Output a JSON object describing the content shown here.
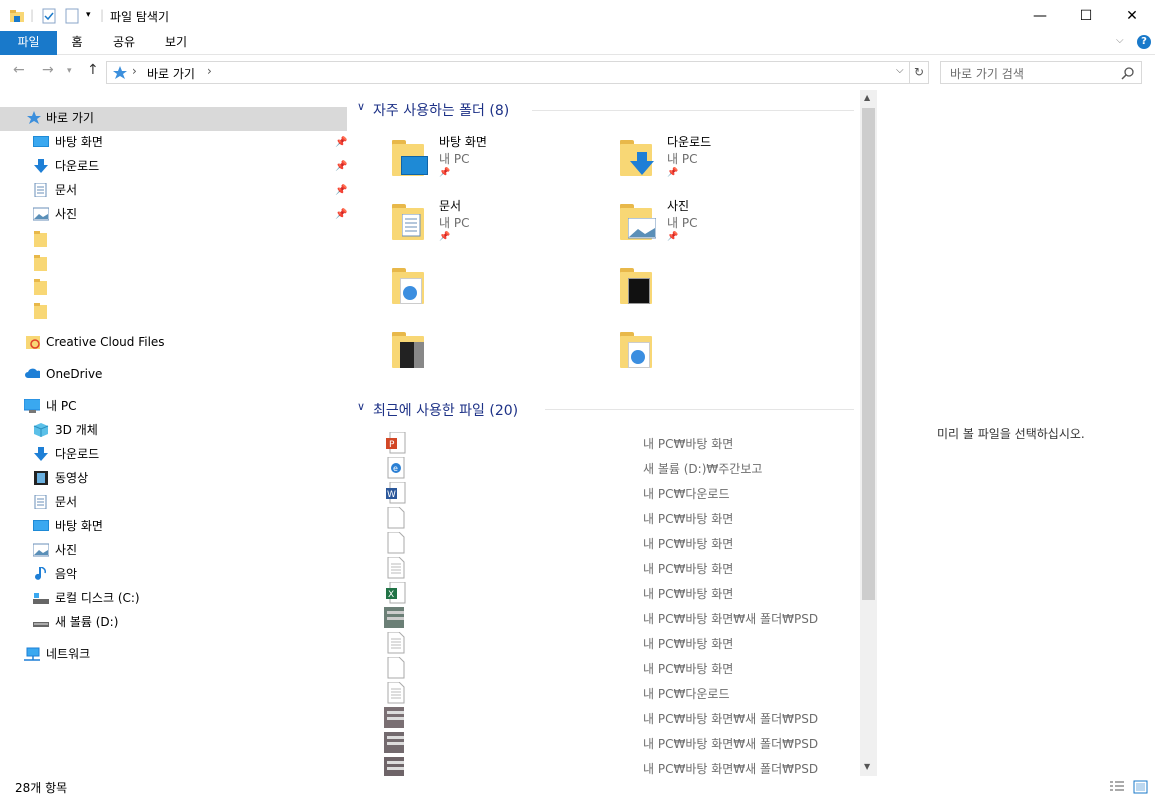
{
  "window": {
    "title": "파일 탐색기",
    "minimize_symbol": "—",
    "maximize_symbol": "☐",
    "close_symbol": "✕"
  },
  "ribbon": {
    "tabs": [
      "파일",
      "홈",
      "공유",
      "보기"
    ],
    "help": "?"
  },
  "address": {
    "crumb": "바로 가기",
    "separator": "›"
  },
  "search": {
    "placeholder": "바로 가기 검색"
  },
  "nav": {
    "quick_access": "바로 가기",
    "quick_items": [
      {
        "label": "바탕 화면",
        "icon": "desktop-icon",
        "pinned": true
      },
      {
        "label": "다운로드",
        "icon": "download-icon",
        "pinned": true
      },
      {
        "label": "문서",
        "icon": "documents-icon",
        "pinned": true
      },
      {
        "label": "사진",
        "icon": "pictures-icon",
        "pinned": true
      }
    ],
    "creative_cloud": "Creative Cloud Files",
    "onedrive": "OneDrive",
    "this_pc": "내 PC",
    "pc_items": [
      {
        "label": "3D 개체",
        "icon": "3d-objects-icon"
      },
      {
        "label": "다운로드",
        "icon": "download-icon"
      },
      {
        "label": "동영상",
        "icon": "videos-icon"
      },
      {
        "label": "문서",
        "icon": "documents-icon"
      },
      {
        "label": "바탕 화면",
        "icon": "desktop-icon"
      },
      {
        "label": "사진",
        "icon": "pictures-icon"
      },
      {
        "label": "음악",
        "icon": "music-icon"
      },
      {
        "label": "로컬 디스크 (C:)",
        "icon": "drive-icon"
      },
      {
        "label": "새 볼륨 (D:)",
        "icon": "drive-icon"
      }
    ],
    "network": "네트워크"
  },
  "frequent": {
    "header": "자주 사용하는 폴더 (8)",
    "folders": [
      {
        "name": "바탕 화면",
        "location": "내 PC"
      },
      {
        "name": "다운로드",
        "location": "내 PC"
      },
      {
        "name": "문서",
        "location": "내 PC"
      },
      {
        "name": "사진",
        "location": "내 PC"
      }
    ]
  },
  "recent": {
    "header": "최근에 사용한 파일 (20)",
    "paths": [
      "내 PC₩바탕 화면",
      "새 볼륨 (D:)₩주간보고",
      "내 PC₩다운로드",
      "내 PC₩바탕 화면",
      "내 PC₩바탕 화면",
      "내 PC₩바탕 화면",
      "내 PC₩바탕 화면",
      "내 PC₩바탕 화면₩새 폴더₩PSD",
      "내 PC₩바탕 화면",
      "내 PC₩바탕 화면",
      "내 PC₩다운로드",
      "내 PC₩바탕 화면₩새 폴더₩PSD",
      "내 PC₩바탕 화면₩새 폴더₩PSD",
      "내 PC₩바탕 화면₩새 폴더₩PSD"
    ]
  },
  "preview": {
    "message": "미리 볼 파일을 선택하십시오."
  },
  "status": {
    "count": "28개 항목"
  },
  "colors": {
    "accent": "#1979ca",
    "folder": "#f8d775",
    "header": "#1e3287"
  }
}
